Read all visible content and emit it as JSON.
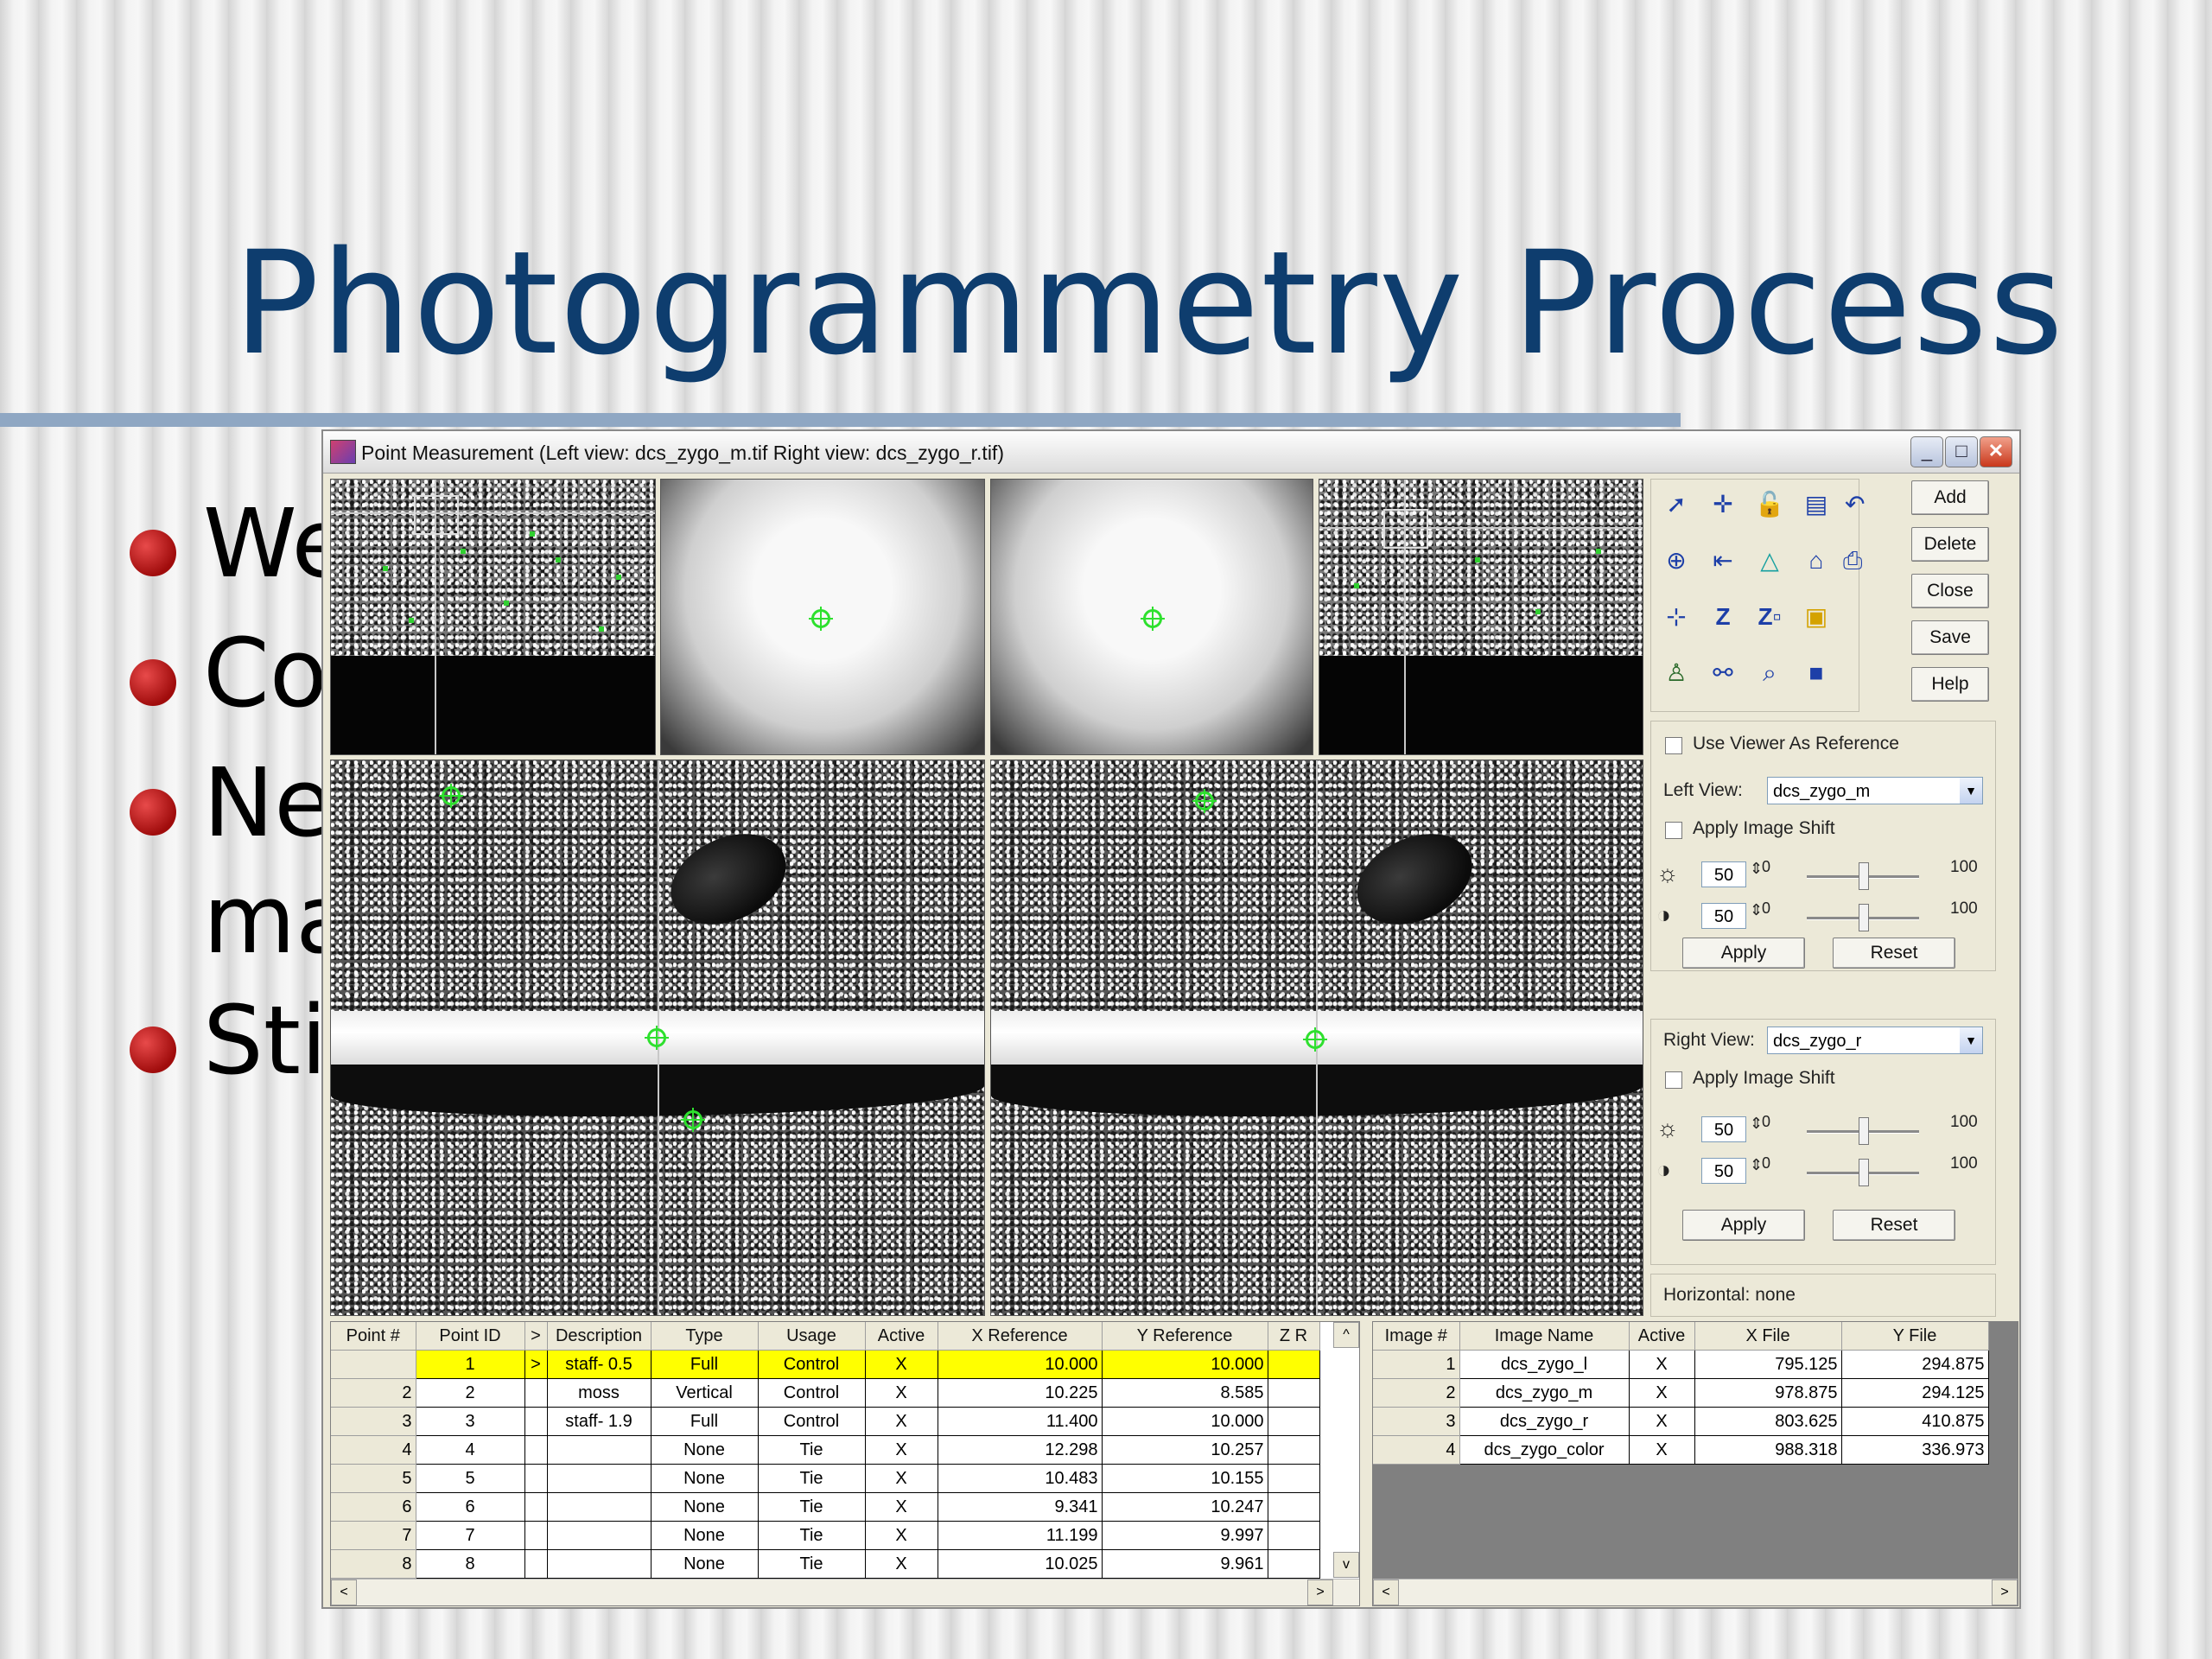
{
  "slide": {
    "title": "Photogrammetry Process",
    "bullets": [
      "We",
      "Co",
      "Ne",
      "ma",
      "Sti"
    ]
  },
  "window": {
    "title": "Point Measurement (Left view: dcs_zygo_m.tif  Right view: dcs_zygo_r.tif)",
    "buttons": {
      "minimize": "_",
      "maximize": "□",
      "close": "✕"
    }
  },
  "side_buttons": [
    "Add",
    "Delete",
    "Close",
    "Save",
    "Help"
  ],
  "left_view": {
    "use_viewer_as_reference_label": "Use Viewer As Reference",
    "label": "Left View:",
    "value": "dcs_zygo_m",
    "apply_shift_label": "Apply Image Shift",
    "brightness": "50",
    "contrast": "50",
    "min": "0",
    "max": "100",
    "apply": "Apply",
    "reset": "Reset"
  },
  "right_view": {
    "label": "Right View:",
    "value": "dcs_zygo_r",
    "apply_shift_label": "Apply Image Shift",
    "brightness": "50",
    "contrast": "50",
    "min": "0",
    "max": "100",
    "apply": "Apply",
    "reset": "Reset"
  },
  "horizontal_label": "Horizontal: none",
  "point_table": {
    "headers": [
      "Point #",
      "Point ID",
      ">",
      "Description",
      "Type",
      "Usage",
      "Active",
      "X Reference",
      "Y Reference",
      "Z R"
    ],
    "rows": [
      [
        "1",
        ">",
        "staff- 0.5",
        "Full",
        "Control",
        "X",
        "10.000",
        "10.000"
      ],
      [
        "2",
        "",
        "moss",
        "Vertical",
        "Control",
        "X",
        "10.225",
        "8.585"
      ],
      [
        "3",
        "",
        "staff- 1.9",
        "Full",
        "Control",
        "X",
        "11.400",
        "10.000"
      ],
      [
        "4",
        "",
        "",
        "None",
        "Tie",
        "X",
        "12.298",
        "10.257"
      ],
      [
        "5",
        "",
        "",
        "None",
        "Tie",
        "X",
        "10.483",
        "10.155"
      ],
      [
        "6",
        "",
        "",
        "None",
        "Tie",
        "X",
        "9.341",
        "10.247"
      ],
      [
        "7",
        "",
        "",
        "None",
        "Tie",
        "X",
        "11.199",
        "9.997"
      ],
      [
        "8",
        "",
        "",
        "None",
        "Tie",
        "X",
        "10.025",
        "9.961"
      ]
    ],
    "selected_row": 0
  },
  "image_table": {
    "headers": [
      "Image #",
      "Image Name",
      "Active",
      "X File",
      "Y File"
    ],
    "rows": [
      [
        "1",
        "dcs_zygo_l",
        "X",
        "795.125",
        "294.875"
      ],
      [
        "2",
        "dcs_zygo_m",
        "X",
        "978.875",
        "294.125"
      ],
      [
        "3",
        "dcs_zygo_r",
        "X",
        "803.625",
        "410.875"
      ],
      [
        "4",
        "dcs_zygo_color",
        "X",
        "988.318",
        "336.973"
      ]
    ]
  },
  "icons": [
    "select-arrow-icon",
    "crosshair-icon",
    "lock-icon",
    "table-icon",
    "undo-icon",
    "add-point-icon",
    "import-icon",
    "triangle-icon",
    "house-icon",
    "export-icon",
    "tie-icon",
    "z-icon",
    "z-box-icon",
    "square-icon",
    "person-icon",
    "link-icon",
    "zoom-icon",
    "stop-icon"
  ],
  "colors": {
    "title": "#0e3d6e",
    "selected_row": "#ffff00",
    "points": "#2ee02e",
    "bullet": "#c0141a"
  }
}
